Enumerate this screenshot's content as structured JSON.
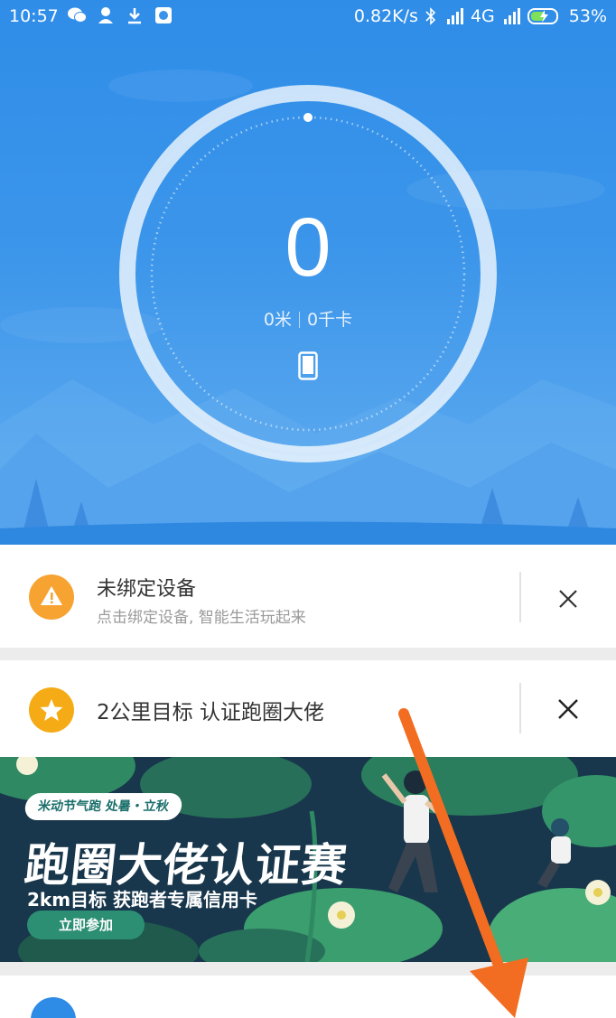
{
  "status_bar": {
    "time": "10:57",
    "net_speed": "0.82K/s",
    "network": "4G",
    "battery": "53%",
    "icons": [
      "wechat-icon",
      "person-pin-icon",
      "download-icon",
      "gallery-icon",
      "bluetooth-icon",
      "hd-signal-icon",
      "4g-signal-icon",
      "battery-charging-icon"
    ]
  },
  "hero": {
    "steps": "0",
    "distance": "0米",
    "calories": "0千卡",
    "device_icon": "phone-icon",
    "colors": {
      "top": "#2f8de8",
      "bottom": "#5eabf0"
    }
  },
  "cards": {
    "bind_device": {
      "icon": "warning-icon",
      "title": "未绑定设备",
      "subtitle": "点击绑定设备, 智能生活玩起来",
      "close_icon": "close-icon",
      "icon_color": "#f7a332"
    },
    "goal": {
      "icon": "star-icon",
      "title": "2公里目标 认证跑圈大佬",
      "close_icon": "close-icon",
      "icon_color": "#f5ab16"
    }
  },
  "banner": {
    "tag": "米动节气跑 处暑・立秋",
    "title": "跑圈大佬认证赛",
    "subtitle": "2km目标 获跑者专属信用卡",
    "button": "立即参加"
  },
  "overlay": {
    "arrow_color": "#f26d21"
  }
}
